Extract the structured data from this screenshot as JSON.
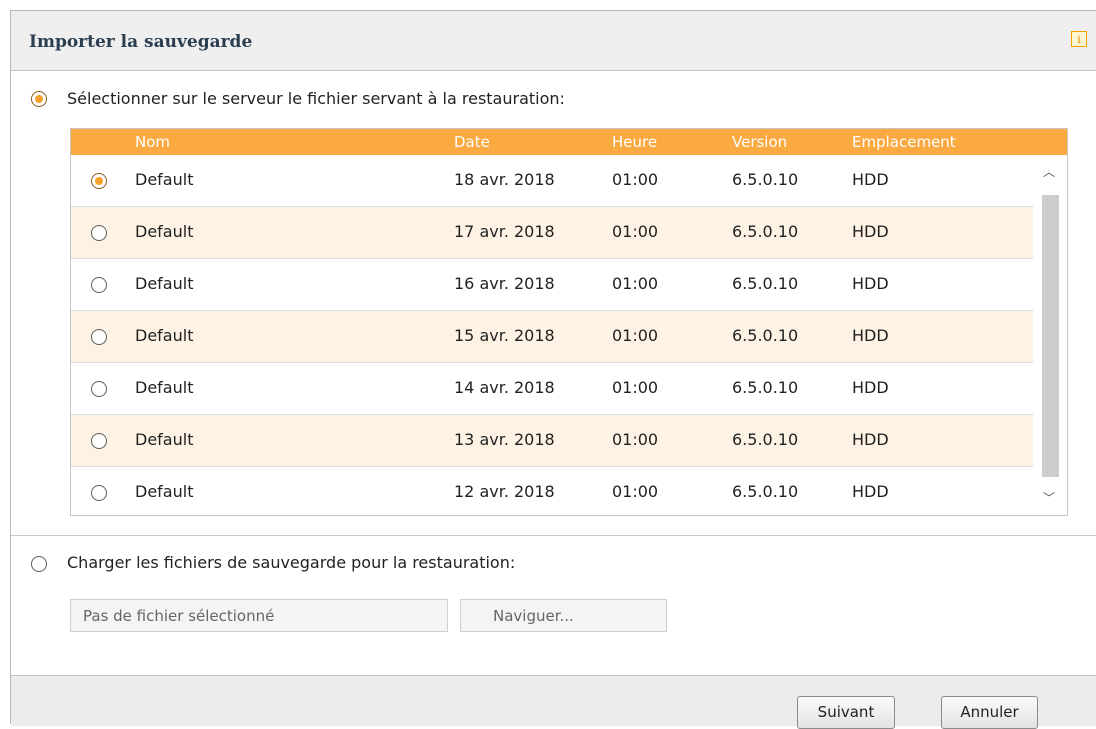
{
  "dialog": {
    "title": "Importer la sauvegarde",
    "info_icon": "info-icon"
  },
  "option_server": {
    "label": "Sélectionner sur le serveur le fichier servant à la restauration:",
    "selected": true
  },
  "table": {
    "columns": [
      "Nom",
      "Date",
      "Heure",
      "Version",
      "Emplacement"
    ],
    "rows": [
      {
        "name": "Default",
        "date": "18 avr. 2018",
        "time": "01:00",
        "version": "6.5.0.10",
        "location": "HDD",
        "selected": true
      },
      {
        "name": "Default",
        "date": "17 avr. 2018",
        "time": "01:00",
        "version": "6.5.0.10",
        "location": "HDD",
        "selected": false
      },
      {
        "name": "Default",
        "date": "16 avr. 2018",
        "time": "01:00",
        "version": "6.5.0.10",
        "location": "HDD",
        "selected": false
      },
      {
        "name": "Default",
        "date": "15 avr. 2018",
        "time": "01:00",
        "version": "6.5.0.10",
        "location": "HDD",
        "selected": false
      },
      {
        "name": "Default",
        "date": "14 avr. 2018",
        "time": "01:00",
        "version": "6.5.0.10",
        "location": "HDD",
        "selected": false
      },
      {
        "name": "Default",
        "date": "13 avr. 2018",
        "time": "01:00",
        "version": "6.5.0.10",
        "location": "HDD",
        "selected": false
      },
      {
        "name": "Default",
        "date": "12 avr. 2018",
        "time": "01:00",
        "version": "6.5.0.10",
        "location": "HDD",
        "selected": false
      }
    ]
  },
  "option_upload": {
    "label": "Charger les fichiers de sauvegarde pour la restauration:",
    "selected": false,
    "file_placeholder": "Pas de fichier sélectionné",
    "browse_label": "Naviguer..."
  },
  "footer": {
    "next_label": "Suivant",
    "cancel_label": "Annuler"
  },
  "colors": {
    "accent": "#fba941",
    "row_alt": "#fdf2e4"
  }
}
